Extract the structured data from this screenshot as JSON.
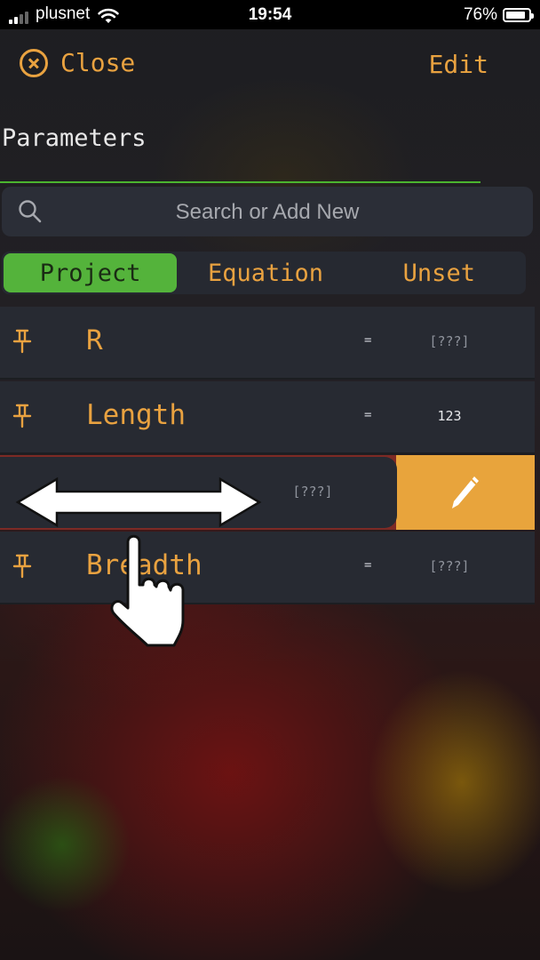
{
  "status_bar": {
    "carrier": "plusnet",
    "time": "19:54",
    "battery": "76%"
  },
  "nav": {
    "close_label": "Close",
    "edit_label": "Edit"
  },
  "page_title": "Parameters",
  "search": {
    "placeholder": "Search or Add New"
  },
  "segments": [
    {
      "label": "Project",
      "selected": true
    },
    {
      "label": "Equation",
      "selected": false
    },
    {
      "label": "Unset",
      "selected": false
    }
  ],
  "rows": [
    {
      "name": "R",
      "eq": "=",
      "value": "[???]"
    },
    {
      "name": "Length",
      "eq": "=",
      "value": "123"
    },
    {
      "name": "",
      "eq": "",
      "value": "[???]"
    },
    {
      "name": "Breadth",
      "eq": "=",
      "value": "[???]"
    }
  ],
  "colors": {
    "accent": "#e9a240",
    "selected_segment": "#54b33b",
    "swipe_action": "#e8a43c",
    "row_bg": "#272a32"
  },
  "icons": {
    "close": "close-circle-icon",
    "search": "search-icon",
    "pin": "pin-icon",
    "edit": "pencil-icon",
    "gesture": "swipe-hand-icon"
  }
}
